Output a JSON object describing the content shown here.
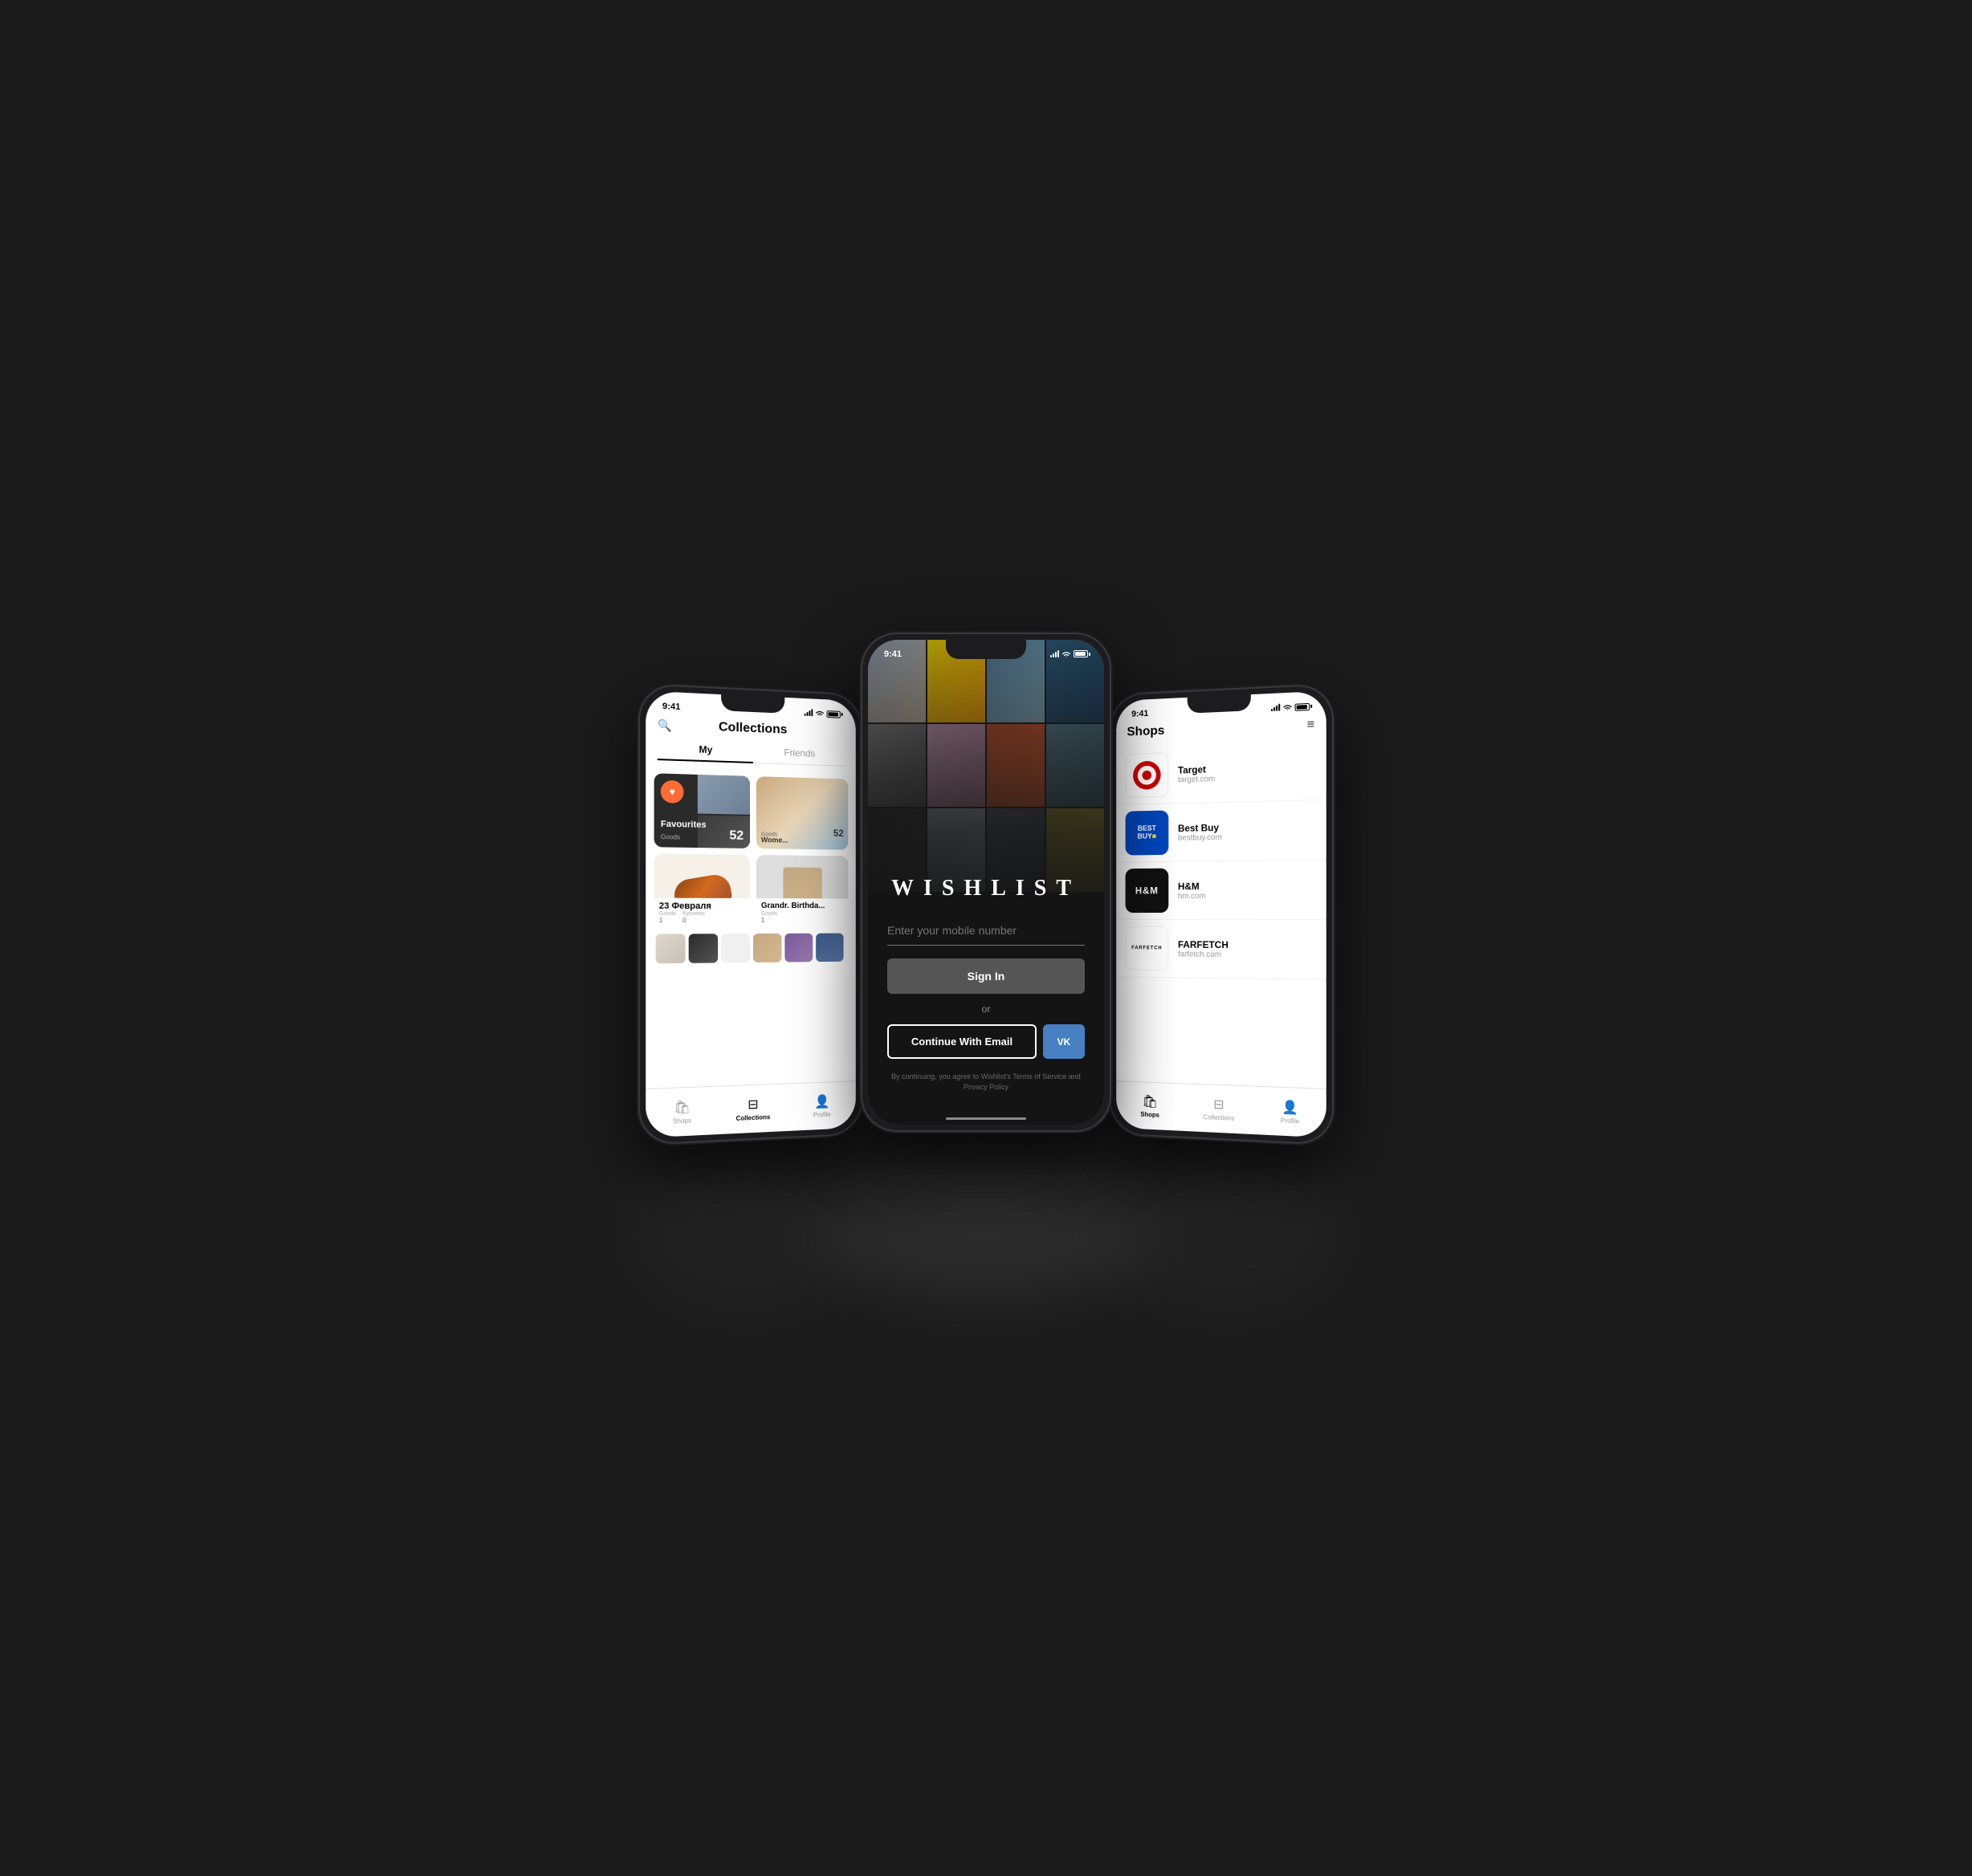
{
  "scene": {
    "bg_color": "#1a1a1a"
  },
  "left_phone": {
    "status_time": "9:41",
    "title": "Collections",
    "tabs": [
      "My",
      "Friends"
    ],
    "active_tab": "My",
    "collections": [
      {
        "id": "favourites",
        "name": "Favourites",
        "goods_label": "Goods",
        "goods_count": "52"
      },
      {
        "id": "women",
        "name": "Wome...",
        "goods_label": "Goods",
        "goods_count": "52"
      },
      {
        "id": "shoe",
        "name": "23 Февраля",
        "goods_label": "Goods",
        "bought_label": "Куплено",
        "goods_count": "1",
        "bought_count": "0"
      },
      {
        "id": "grandr",
        "name": "Grandr. Birthda...",
        "goods_label": "Goods",
        "goods_count": "1"
      }
    ],
    "nav": [
      {
        "id": "shops",
        "label": "Shops",
        "active": false
      },
      {
        "id": "collections",
        "label": "Collections",
        "active": true
      },
      {
        "id": "profile",
        "label": "Profile",
        "active": false
      }
    ]
  },
  "center_phone": {
    "status_time": "9:41",
    "logo": "WISHLIST",
    "input_placeholder": "Enter your mobile number",
    "sign_in_label": "Sign In",
    "or_label": "or",
    "email_btn_label": "Continue With Email",
    "vk_btn_label": "VK",
    "terms": "By continuing, you agree to Wishlist's Terms of Service and Privacy Policy"
  },
  "right_phone": {
    "status_time": "9:41",
    "title": "Shops",
    "shops": [
      {
        "id": "target",
        "name": "Target",
        "url": "target.com",
        "logo_type": "target"
      },
      {
        "id": "bestbuy",
        "name": "Best Buy",
        "url": "bestbuy.com",
        "logo_type": "bestbuy"
      },
      {
        "id": "hm",
        "name": "H&M",
        "url": "hm.com",
        "logo_type": "hm",
        "logo_text": "H&M"
      },
      {
        "id": "farfetch",
        "name": "FARFETCH",
        "url": "farfetch.com",
        "logo_type": "farfetch",
        "logo_text": "FARFETCH"
      }
    ],
    "nav": [
      {
        "id": "shops",
        "label": "Shops",
        "active": true
      },
      {
        "id": "collections",
        "label": "Collections",
        "active": false
      },
      {
        "id": "profile",
        "label": "Profile",
        "active": false
      }
    ]
  }
}
